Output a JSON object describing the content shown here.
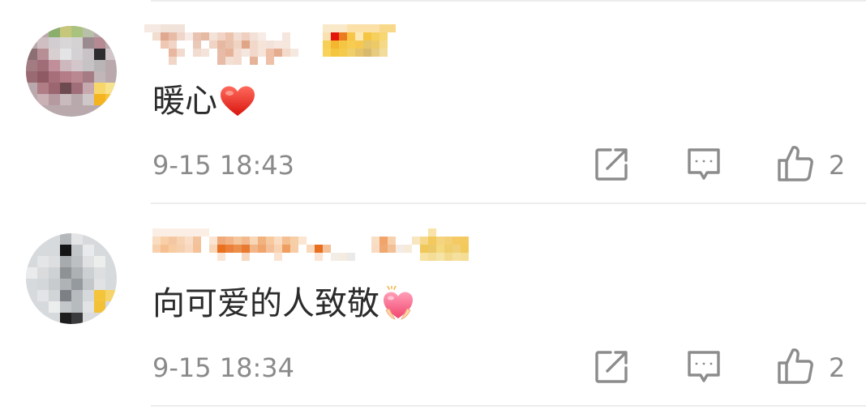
{
  "comments": [
    {
      "text": "暖心",
      "emoji": "red-heart-icon",
      "timestamp": "9-15 18:43",
      "like_count": "2"
    },
    {
      "text": "向可爱的人致敬",
      "emoji": "pink-heart-hands-icon",
      "timestamp": "9-15 18:34",
      "like_count": "2"
    }
  ],
  "icons": {
    "share": "share-icon",
    "reply": "comment-icon",
    "like": "thumbs-up-icon"
  },
  "colors": {
    "text": "#2b2b2b",
    "meta": "#8a8a8a",
    "icon": "#8c8c8c",
    "divider": "#ececec"
  }
}
